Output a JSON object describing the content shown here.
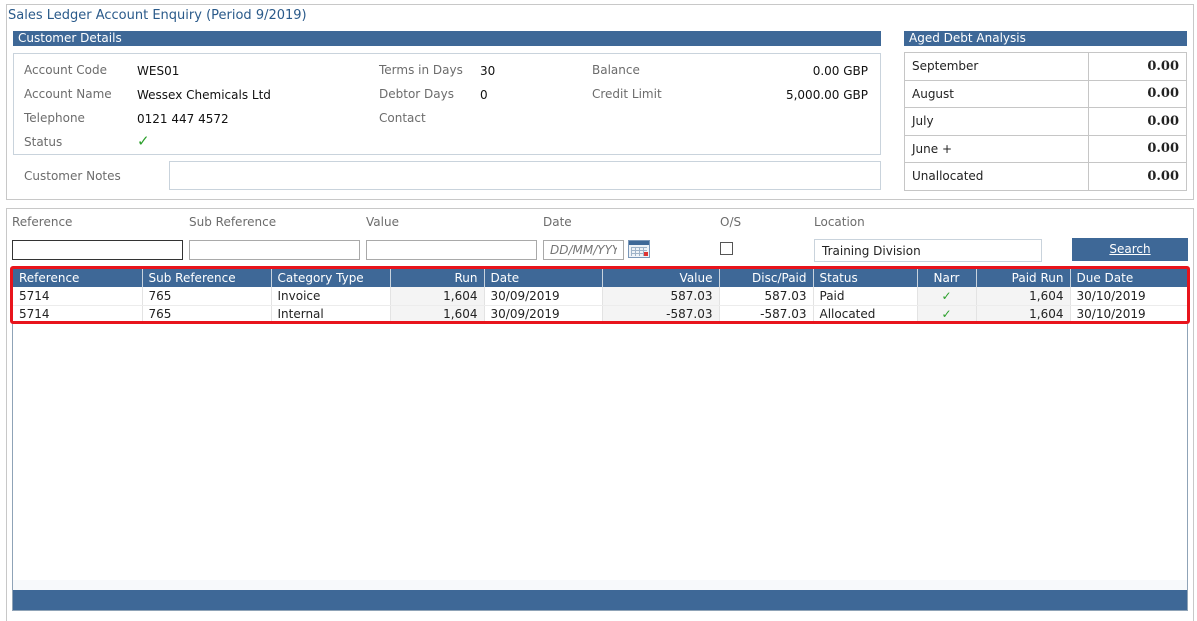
{
  "page_title": "Sales Ledger Account Enquiry (Period 9/2019)",
  "customer_details": {
    "header": "Customer Details",
    "account_code_label": "Account Code",
    "account_code": "WES01",
    "account_name_label": "Account Name",
    "account_name": "Wessex Chemicals Ltd",
    "telephone_label": "Telephone",
    "telephone": "0121 447 4572",
    "status_label": "Status",
    "status_icon": "check-icon",
    "status_glyph": "✓",
    "terms_label": "Terms in Days",
    "terms": "30",
    "debtor_days_label": "Debtor Days",
    "debtor_days": "0",
    "contact_label": "Contact",
    "balance_label": "Balance",
    "balance": "0.00 GBP",
    "credit_limit_label": "Credit Limit",
    "credit_limit": "5,000.00 GBP",
    "notes_label": "Customer Notes",
    "notes_value": ""
  },
  "aged_debt": {
    "header": "Aged Debt Analysis",
    "rows": [
      {
        "label": "September",
        "amount": "0.00"
      },
      {
        "label": "August",
        "amount": "0.00"
      },
      {
        "label": "July",
        "amount": "0.00"
      },
      {
        "label": "June +",
        "amount": "0.00"
      },
      {
        "label": "Unallocated",
        "amount": "0.00"
      }
    ]
  },
  "filters": {
    "reference_label": "Reference",
    "reference_value": "",
    "sub_reference_label": "Sub Reference",
    "sub_reference_value": "",
    "value_label": "Value",
    "value_value": "",
    "date_label": "Date",
    "date_placeholder": "DD/MM/YYYY",
    "os_label": "O/S",
    "os_checked": false,
    "location_label": "Location",
    "location_value": "Training Division",
    "search_label": "Search"
  },
  "results": {
    "columns": [
      "Reference",
      "Sub Reference",
      "Category Type",
      "Run",
      "Date",
      "Value",
      "Disc/Paid",
      "Status",
      "Narr",
      "Paid Run",
      "Due Date"
    ],
    "rows": [
      {
        "reference": "5714",
        "sub_reference": "765",
        "category_type": "Invoice",
        "run": "1,604",
        "date": "30/09/2019",
        "value": "587.03",
        "disc_paid": "587.03",
        "status": "Paid",
        "narr": "✓",
        "paid_run": "1,604",
        "due_date": "30/10/2019"
      },
      {
        "reference": "5714",
        "sub_reference": "765",
        "category_type": "Internal",
        "run": "1,604",
        "date": "30/09/2019",
        "value": "-587.03",
        "disc_paid": "-587.03",
        "status": "Allocated",
        "narr": "✓",
        "paid_run": "1,604",
        "due_date": "30/10/2019"
      }
    ]
  },
  "colors": {
    "header_blue": "#3e6897",
    "highlight_red": "#e8141c",
    "check_green": "#2ca02c"
  }
}
